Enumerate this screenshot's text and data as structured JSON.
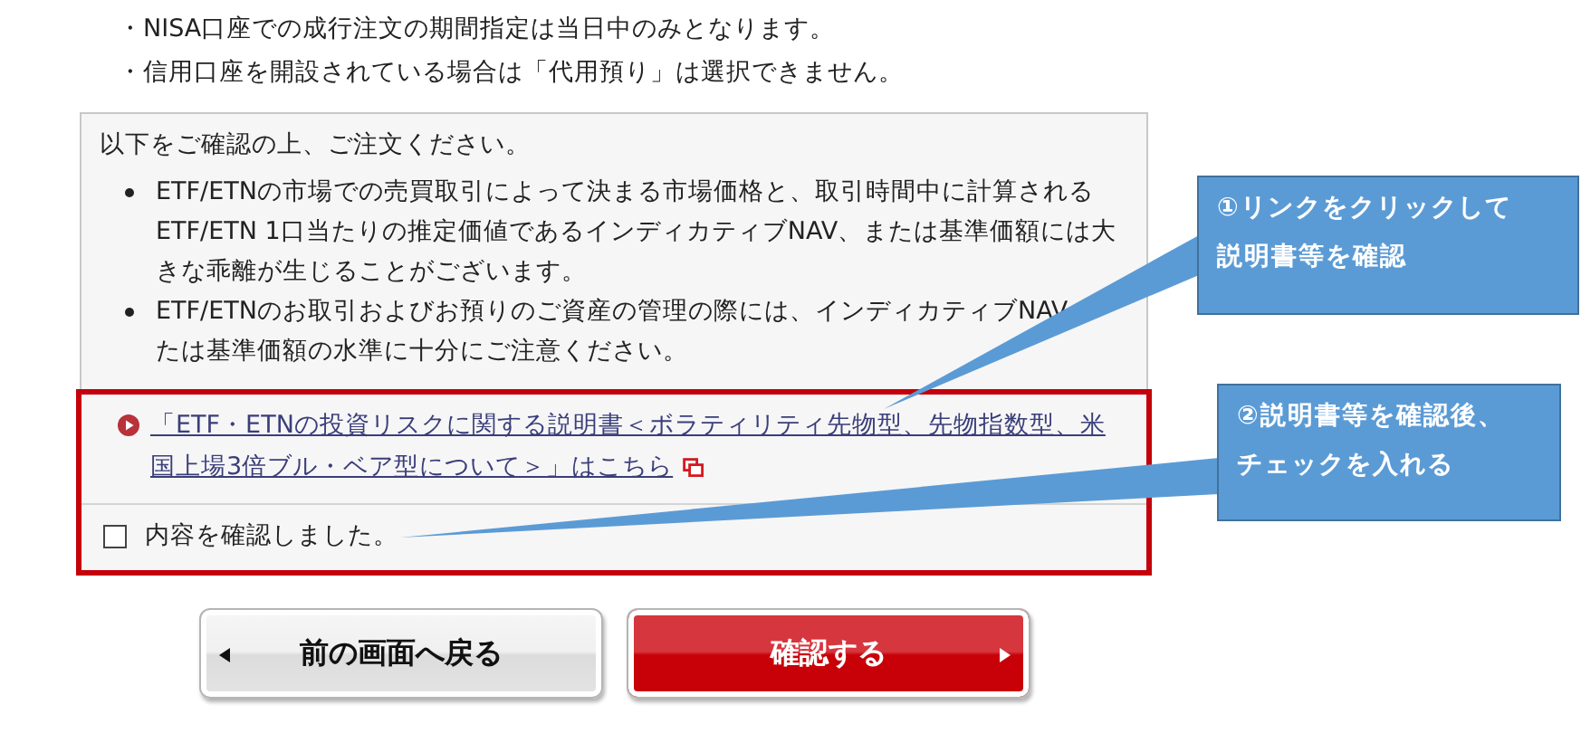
{
  "notes": [
    "・NISA口座での成行注文の期間指定は当日中のみとなります。",
    "・信用口座を開設されている場合は「代用預り」は選択できません。"
  ],
  "panel": {
    "heading": "以下をご確認の上、ご注文ください。",
    "bullets": [
      {
        "lines": [
          "ETF/ETNの市場での売買取引によって決まる市場価格と、取引時間中に計算される",
          "ETF/ETN 1口当たりの推定価値であるインディカティブNAV、または基準価額には大",
          "きな乖離が生じることがございます。"
        ]
      },
      {
        "lines": [
          "ETF/ETNのお取引およびお預りのご資産の管理の際には、インディカティブNAV",
          "たは基準価額の水準に十分にご注意ください。"
        ]
      }
    ],
    "link": {
      "lines": [
        "「ETF・ETNの投資リスクに関する説明書＜ボラティリティ先物型、先物指数型、米",
        "国上場3倍ブル・ベア型について＞」はこちら"
      ]
    },
    "confirm": {
      "label": "内容を確認しました。",
      "checked": false
    }
  },
  "callouts": [
    {
      "lines": [
        "①リンクをクリックして",
        "説明書等を確認"
      ]
    },
    {
      "lines": [
        "②説明書等を確認後、",
        "チェックを入れる"
      ]
    }
  ],
  "buttons": [
    {
      "kind": "back",
      "label": "前の画面へ戻る"
    },
    {
      "kind": "submit",
      "label": "確認する"
    }
  ]
}
